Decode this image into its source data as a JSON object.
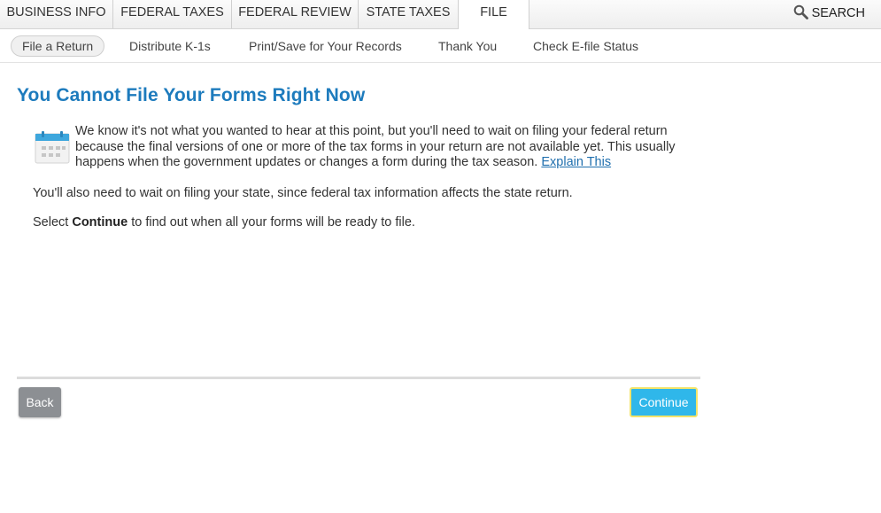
{
  "top_tabs": [
    {
      "label": "BUSINESS INFO"
    },
    {
      "label": "FEDERAL TAXES"
    },
    {
      "label": "FEDERAL REVIEW"
    },
    {
      "label": "STATE TAXES"
    },
    {
      "label": "FILE",
      "active": true
    }
  ],
  "search": {
    "label": "SEARCH",
    "icon": "search-icon"
  },
  "sub_tabs": [
    {
      "label": "File a Return",
      "active": true
    },
    {
      "label": "Distribute K-1s"
    },
    {
      "label": "Print/Save for Your Records"
    },
    {
      "label": "Thank You"
    },
    {
      "label": "Check E-file Status"
    }
  ],
  "main": {
    "title": "You Cannot File Your Forms Right Now",
    "icon": "calendar-icon",
    "message": "We know it's not what you wanted to hear at this point, but you'll need to wait on filing your federal return because the final versions of one or more of the tax forms in your return are not available yet. This usually happens when the government updates or changes a form during the tax season.",
    "link": "Explain This",
    "state_note": "You'll also need to wait on filing your state, since federal tax information affects the state return.",
    "continue_prefix": "Select ",
    "continue_word": "Continue",
    "continue_suffix": " to find out when all your forms will be ready to file."
  },
  "footer": {
    "back_label": "Back",
    "continue_label": "Continue"
  },
  "colors": {
    "title": "#1d7bbd",
    "continue_button": "#2fb7ea",
    "back_button": "#8c8f93",
    "link": "#1f6fae"
  }
}
